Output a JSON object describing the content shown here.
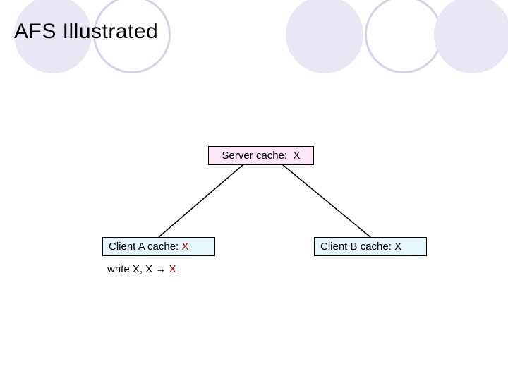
{
  "title": "AFS Illustrated",
  "server": {
    "label": "Server cache:",
    "value": "X"
  },
  "clientA": {
    "label": "Client A cache:",
    "value": "X"
  },
  "clientB": {
    "label": "Client B cache:",
    "value": "X"
  },
  "action": {
    "prefix": "write X, X ",
    "arrow": "→",
    "newval": " X"
  },
  "colors": {
    "circle_border": "#d6d3e8",
    "circle_fill": "#e9e7f3",
    "server_bg": "#fde6f6",
    "client_bg": "#e6f7fb",
    "value_red": "#c00000"
  }
}
